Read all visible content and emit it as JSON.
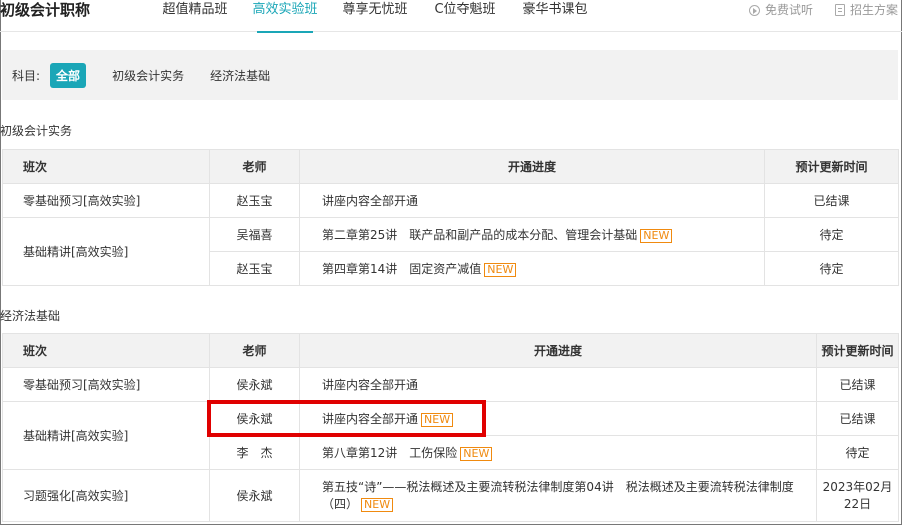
{
  "header": {
    "brand": "初级会计职称",
    "tabs": [
      {
        "label": "超值精品班",
        "active": false
      },
      {
        "label": "高效实验班",
        "active": true
      },
      {
        "label": "尊享无忧班",
        "active": false
      },
      {
        "label": "C位夺魁班",
        "active": false
      },
      {
        "label": "豪华书课包",
        "active": false
      }
    ],
    "free_trial": "免费试听",
    "enroll_plan": "招生方案"
  },
  "filter": {
    "label": "科目:",
    "chips": [
      {
        "label": "全部",
        "active": true
      },
      {
        "label": "初级会计实务",
        "active": false
      },
      {
        "label": "经济法基础",
        "active": false
      }
    ]
  },
  "new_label": "NEW",
  "sections": [
    {
      "title": "初级会计实务",
      "columns": [
        "班次",
        "老师",
        "开通进度",
        "预计更新时间"
      ],
      "rows": [
        {
          "class": "零基础预习[高效实验]",
          "teacher": "赵玉宝",
          "progress": "讲座内容全部开通",
          "new": false,
          "update": "已结课"
        },
        {
          "class": "基础精讲[高效实验]",
          "teacher": "吴福喜",
          "progress": "第二章第25讲　联产品和副产品的成本分配、管理会计基础",
          "new": true,
          "update": "待定"
        },
        {
          "class": "",
          "teacher": "赵玉宝",
          "progress": "第四章第14讲　固定资产减值",
          "new": true,
          "update": "待定"
        }
      ]
    },
    {
      "title": "经济法基础",
      "columns": [
        "班次",
        "老师",
        "开通进度",
        "预计更新时间"
      ],
      "rows": [
        {
          "class": "零基础预习[高效实验]",
          "teacher": "侯永斌",
          "progress": "讲座内容全部开通",
          "new": false,
          "update": "已结课"
        },
        {
          "class": "基础精讲[高效实验]",
          "teacher": "侯永斌",
          "progress": "讲座内容全部开通",
          "new": true,
          "update": "已结课"
        },
        {
          "class": "",
          "teacher": "李　杰",
          "progress": "第八章第12讲　工伤保险",
          "new": true,
          "update": "待定"
        },
        {
          "class": "习题强化[高效实验]",
          "teacher": "侯永斌",
          "progress": "第五技“诗”——税法概述及主要流转税法律制度第04讲　税法概述及主要流转税法律制度（四）",
          "new": true,
          "update": "2023年02月22日"
        }
      ]
    }
  ]
}
